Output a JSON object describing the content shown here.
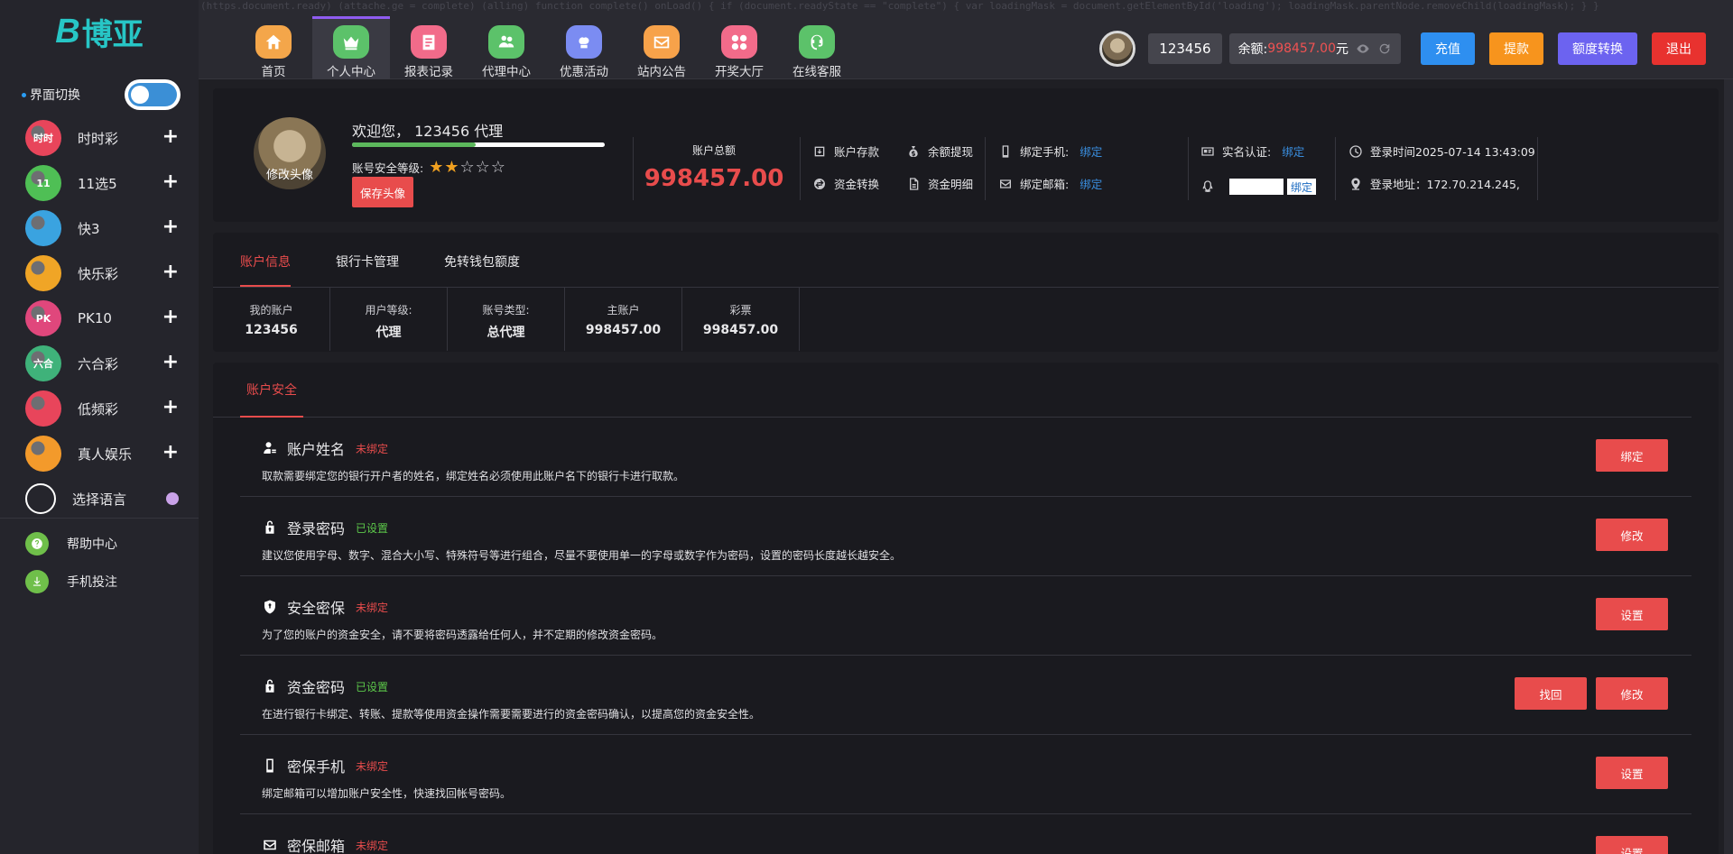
{
  "logo": {
    "mark": "B",
    "text": "博亚"
  },
  "top_code_text": "(https.document.ready) (attache.ge = complete) (alling) function complete() onLoad() { if (document.readyState == \"complete\") { var loadingMask = document.getElementById('loading'); loadingMask.parentNode.removeChild(loadingMask); } }",
  "nav": [
    {
      "label": "首页",
      "icon": "home-icon",
      "color": "#f4a64a"
    },
    {
      "label": "个人中心",
      "icon": "crown-icon",
      "color": "#5cc26a"
    },
    {
      "label": "报表记录",
      "icon": "report-icon",
      "color": "#f26b8a"
    },
    {
      "label": "代理中心",
      "icon": "agent-icon",
      "color": "#5cc26a"
    },
    {
      "label": "优惠活动",
      "icon": "gift-icon",
      "color": "#7b8cf2"
    },
    {
      "label": "站内公告",
      "icon": "mail-icon",
      "color": "#f7a24a"
    },
    {
      "label": "开奖大厅",
      "icon": "grid-icon",
      "color": "#f26b8a"
    },
    {
      "label": "在线客服",
      "icon": "support-icon",
      "color": "#5cc26a"
    }
  ],
  "header": {
    "username": "123456",
    "balance_label": "余额:",
    "balance": "998457.00",
    "balance_unit": "元",
    "recharge": "充值",
    "withdraw": "提款",
    "transfer": "额度转换",
    "logout": "退出",
    "colors": {
      "recharge": "#2e8ff0",
      "withdraw": "#f7941d",
      "transfer": "#6c63f0",
      "logout": "#e8322f"
    }
  },
  "sidebar": {
    "theme_switch": "界面切换",
    "items": [
      {
        "label": "时时彩",
        "icon": "ssc-icon",
        "badge": "时时",
        "color": "#e8455b"
      },
      {
        "label": "11选5",
        "icon": "11x5-icon",
        "badge": "11",
        "color": "#4fbf55"
      },
      {
        "label": "快3",
        "icon": "k3-icon",
        "badge": "",
        "color": "#3aa3e0"
      },
      {
        "label": "快乐彩",
        "icon": "happy-icon",
        "badge": "",
        "color": "#f0a526"
      },
      {
        "label": "PK10",
        "icon": "pk10-icon",
        "badge": "PK",
        "color": "#e0477c"
      },
      {
        "label": "六合彩",
        "icon": "lhc-icon",
        "badge": "六合",
        "color": "#3fb27a"
      },
      {
        "label": "低频彩",
        "icon": "lowfreq-icon",
        "badge": "",
        "color": "#e8455b"
      },
      {
        "label": "真人娱乐",
        "icon": "live-icon",
        "badge": "",
        "color": "#f39a2b"
      },
      {
        "label": "选择语言",
        "icon": "language-icon",
        "badge": "",
        "color": "#ffffff"
      }
    ],
    "bottom": [
      {
        "label": "帮助中心",
        "icon": "help-icon"
      },
      {
        "label": "手机投注",
        "icon": "download-icon"
      }
    ]
  },
  "profile": {
    "change_avatar": "修改头像",
    "welcome": "欢迎您， 123456 代理",
    "security_level_label": "账号安全等级:",
    "security_stars": 2,
    "security_stars_max": 5,
    "security_progress": 0.49,
    "save_avatar": "保存头像",
    "total_label": "账户总额",
    "total_value": "998457.00",
    "deposit": "账户存款",
    "withdraw": "余额提现",
    "transfer": "资金转换",
    "details": "资金明细",
    "phone_label": "绑定手机:",
    "phone_action": "绑定",
    "email_label": "绑定邮箱:",
    "email_action": "绑定",
    "realname_label": "实名认证:",
    "realname_action": "绑定",
    "qq_bind": "绑定",
    "login_time": "登录时间2025-07-14 13:43:09",
    "login_addr": "登录地址：172.70.214.245,"
  },
  "account_tabs": [
    "账户信息",
    "银行卡管理",
    "免转钱包额度"
  ],
  "account_info": [
    {
      "key": "我的账户",
      "value": "123456"
    },
    {
      "key": "用户等级:",
      "value": "代理"
    },
    {
      "key": "账号类型:",
      "value": "总代理"
    },
    {
      "key": "主账户",
      "value": "998457.00"
    },
    {
      "key": "彩票",
      "value": "998457.00"
    }
  ],
  "security": {
    "tab": "账户安全",
    "rows": [
      {
        "title": "账户姓名",
        "icon": "user-icon",
        "status": "未绑定",
        "ok": false,
        "desc": "取款需要绑定您的银行开户者的姓名，绑定姓名必须使用此账户名下的银行卡进行取款。",
        "buttons": [
          "绑定"
        ]
      },
      {
        "title": "登录密码",
        "icon": "lock-icon",
        "status": "已设置",
        "ok": true,
        "desc": "建议您使用字母、数字、混合大小写、特殊符号等进行组合，尽量不要使用单一的字母或数字作为密码，设置的密码长度越长越安全。",
        "buttons": [
          "修改"
        ]
      },
      {
        "title": "安全密保",
        "icon": "shield-icon",
        "status": "未绑定",
        "ok": false,
        "desc": "为了您的账户的资金安全，请不要将密码透露给任何人，并不定期的修改资金密码。",
        "buttons": [
          "设置"
        ]
      },
      {
        "title": "资金密码",
        "icon": "lock-icon",
        "status": "已设置",
        "ok": true,
        "desc": "在进行银行卡绑定、转账、提款等使用资金操作需要需要进行的资金密码确认，以提高您的资金安全性。",
        "buttons": [
          "找回",
          "修改"
        ]
      },
      {
        "title": "密保手机",
        "icon": "phone-icon",
        "status": "未绑定",
        "ok": false,
        "desc": "绑定邮箱可以增加账户安全性，快速找回帐号密码。",
        "buttons": [
          "设置"
        ]
      },
      {
        "title": "密保邮箱",
        "icon": "mail-icon",
        "status": "未绑定",
        "ok": false,
        "desc": "",
        "buttons": [
          "设置"
        ]
      }
    ]
  }
}
